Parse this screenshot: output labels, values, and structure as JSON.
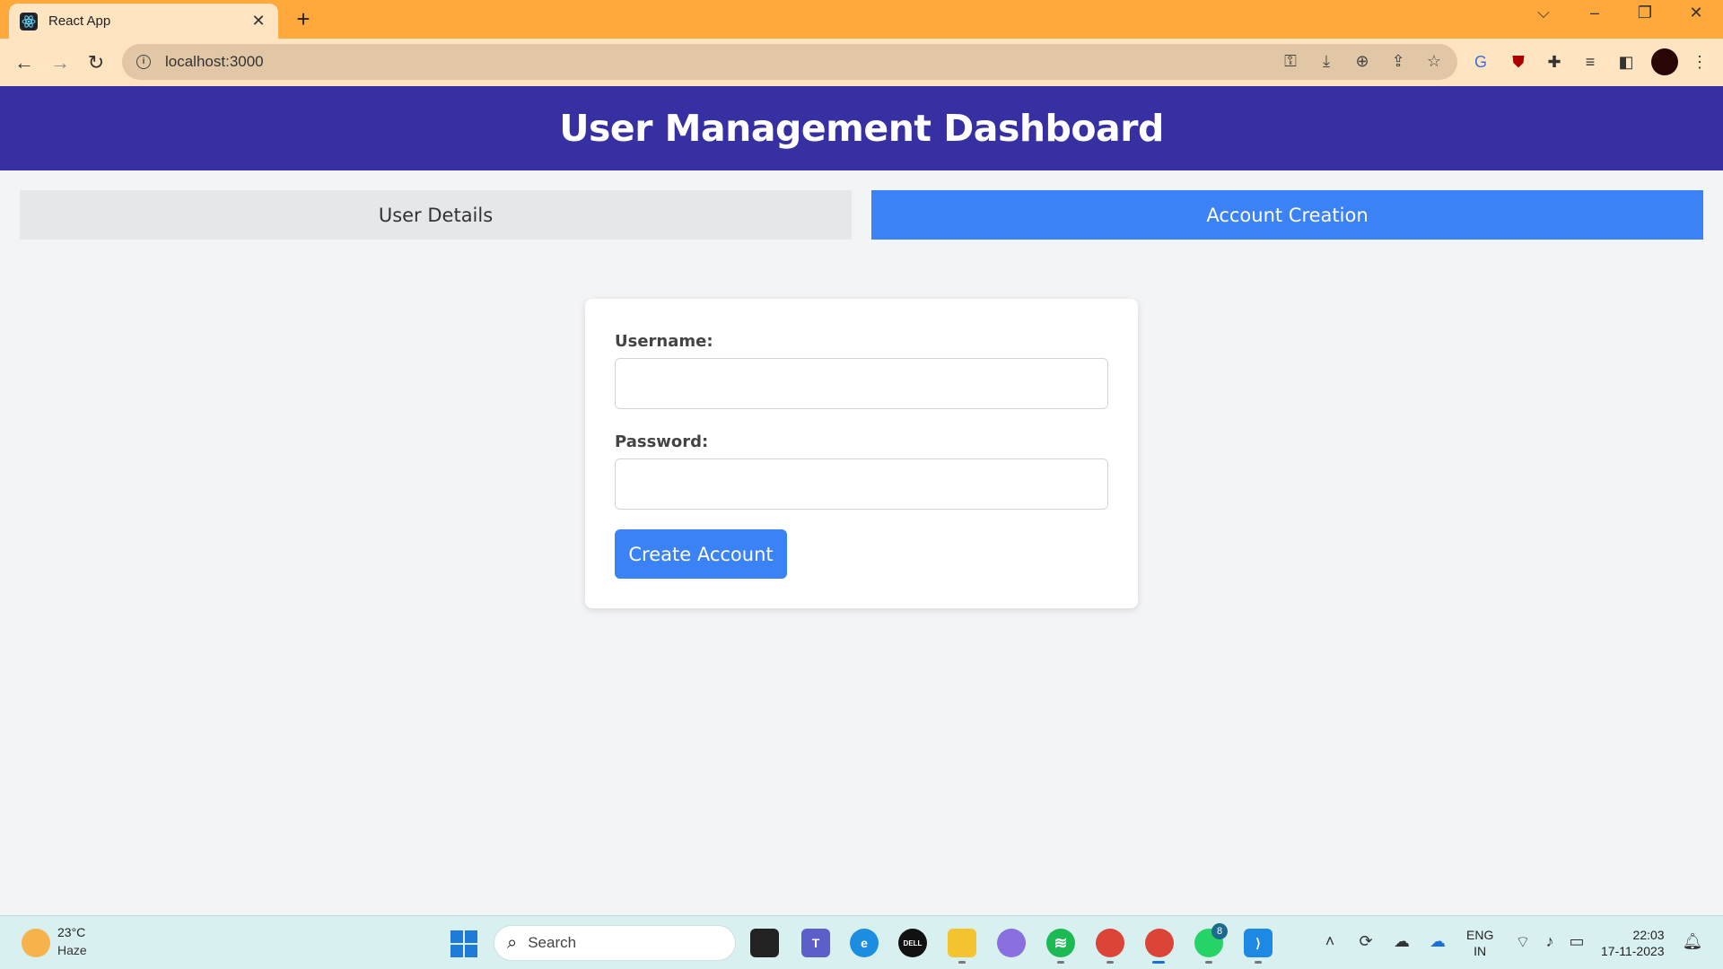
{
  "browser": {
    "tab_title": "React App",
    "new_tab": "+",
    "tab_close": "✕",
    "url": "localhost:3000",
    "win_list": "⌵",
    "win_minimize": "–",
    "win_restore": "❐",
    "win_close": "✕"
  },
  "app": {
    "title": "User Management Dashboard",
    "tabs": [
      {
        "label": "User Details",
        "active": false
      },
      {
        "label": "Account Creation",
        "active": true
      }
    ],
    "form": {
      "username_label": "Username:",
      "username_value": "",
      "password_label": "Password:",
      "password_value": "",
      "submit_label": "Create Account"
    }
  },
  "taskbar": {
    "weather_temp": "23°C",
    "weather_condition": "Haze",
    "search_placeholder": "Search",
    "whatsapp_badge": "8",
    "lang_line1": "ENG",
    "lang_line2": "IN",
    "time": "22:03",
    "date": "17-11-2023",
    "dell_label": "DELL"
  },
  "colors": {
    "header_bg": "#3730a3",
    "active_tab": "#3b82f6",
    "inactive_tab": "#e5e7eb",
    "browser_frame": "#ffa83b"
  }
}
